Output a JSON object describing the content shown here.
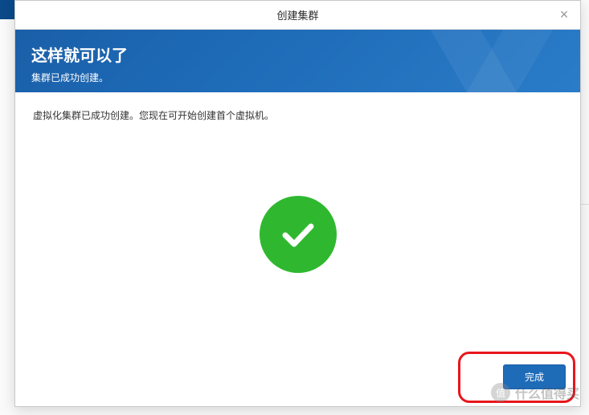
{
  "modal": {
    "title": "创建集群",
    "close_glyph": "×"
  },
  "banner": {
    "title": "这样就可以了",
    "subtitle": "集群已成功创建。"
  },
  "content": {
    "message": "虚拟化集群已成功创建。您现在可开始创建首个虚拟机。"
  },
  "footer": {
    "done_label": "完成"
  },
  "watermark": {
    "icon_char": "值",
    "text": "什么值得买"
  }
}
